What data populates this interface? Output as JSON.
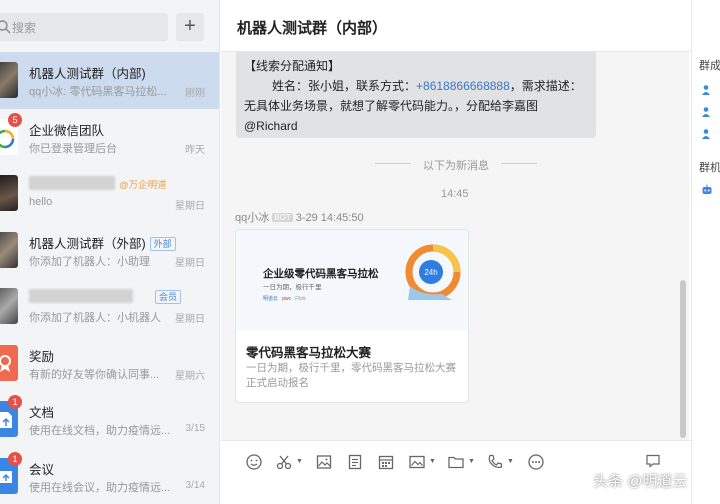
{
  "search": {
    "placeholder": "搜索"
  },
  "colors": {
    "active_item": "#cddbee",
    "badge": "#e6504a",
    "link": "#3b76c2",
    "sidebar": "#f3f4f6"
  },
  "conversations": [
    {
      "title": "机器人测试群（内部)",
      "subtitle": "qq小冰: 零代码黑客马拉松...",
      "time": "刚刚",
      "active": true
    },
    {
      "title": "企业微信团队",
      "subtitle": "你已登录管理后台",
      "time": "昨天",
      "badge": "5"
    },
    {
      "title": "",
      "extra": "@万企明道",
      "subtitle": "hello",
      "time": "星期日"
    },
    {
      "title": "机器人测试群（外部)",
      "tag": "外部",
      "subtitle": "你添加了机器人：小助理",
      "time": "星期日"
    },
    {
      "title": "",
      "tag": "会员",
      "subtitle": "你添加了机器人：小机器人",
      "time": "星期日"
    },
    {
      "title": "奖励",
      "subtitle": "有新的好友等你确认同事...",
      "time": "星期六"
    },
    {
      "title": "文档",
      "subtitle": "使用在线文档，助力疫情远...",
      "time": "3/15",
      "badge": "1"
    },
    {
      "title": "会议",
      "subtitle": "使用在线会议，助力疫情远...",
      "time": "3/14",
      "badge": "1"
    }
  ],
  "chat": {
    "title": "机器人测试群（内部）",
    "message_card": {
      "line1": "【线索分配通知】",
      "line2_prefix": "姓名：张小姐，联系方式：",
      "phone": "+8618866668888",
      "line2_suffix": "，需求描述：",
      "line3": "无具体业务场景，就想了解零代码能力。，分配给李嘉图",
      "line4": "@Richard"
    },
    "new_messages_divider": "以下为新消息",
    "time": "14:45",
    "sender": "qq小冰",
    "sender_tag": "BOT",
    "sent_at": "3-29 14:45:50",
    "link_card": {
      "banner_title": "企业级零代码黑客马拉松",
      "banner_subtitle": "一日为期，极行千里",
      "banner_logo_1": "明道云",
      "banner_logo_2": "pwc",
      "banner_logo_3": "Flink",
      "banner_badge": "24h",
      "title": "零代码黑客马拉松大赛",
      "description": "一日为期，极行千里，零代码黑客马拉松大赛正式启动报名"
    }
  },
  "right_panel": {
    "label_1": "群成",
    "label_2": "群机"
  },
  "watermark": "头条 @明道云"
}
